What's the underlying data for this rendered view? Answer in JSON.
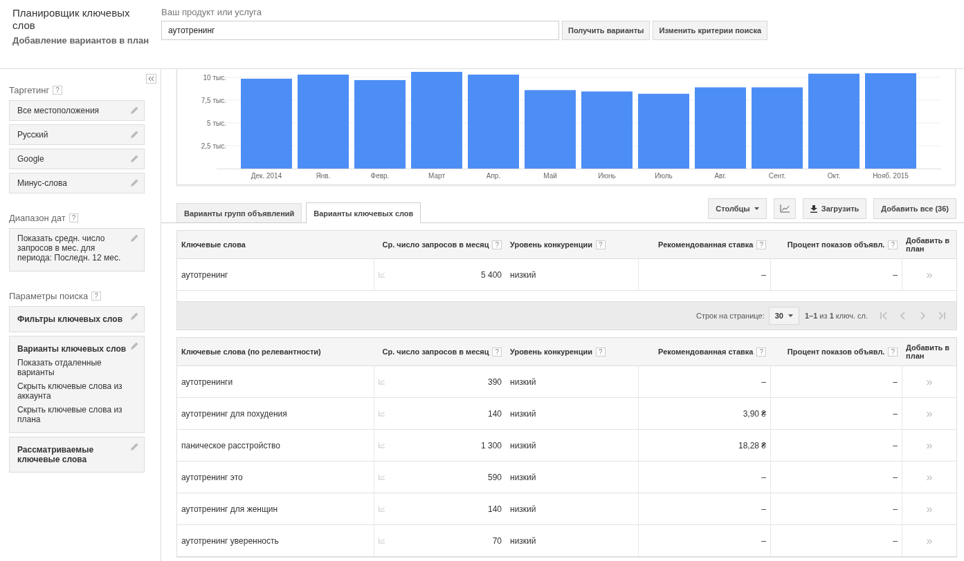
{
  "header": {
    "title": "Планировщик ключевых слов",
    "subtitle": "Добавление вариантов в план",
    "search_label": "Ваш продукт или услуга",
    "search_value": "аутотренинг",
    "buttons": [
      "Получить варианты",
      "Изменить критерии поиска"
    ]
  },
  "sidebar": {
    "sections": [
      {
        "title": "Таргетинг",
        "help": "?",
        "cards": [
          {
            "kind": "plain",
            "text": "Все местоположения"
          },
          {
            "kind": "plain",
            "text": "Русский"
          },
          {
            "kind": "plain",
            "text": "Google"
          },
          {
            "kind": "plain",
            "text": "Минус-слова"
          }
        ]
      },
      {
        "title": "Диапазон дат",
        "help": "?",
        "cards": [
          {
            "kind": "plain",
            "text": "Показать средн. число запросов в мес. для периода: Последн. 12 мес."
          }
        ]
      },
      {
        "title": "Параметры поиска",
        "help": "?",
        "cards": [
          {
            "kind": "bold",
            "text": "Фильтры ключевых слов"
          },
          {
            "kind": "bold",
            "text": "Варианты ключевых слов",
            "lines": [
              "Показать отдаленные варианты",
              "Скрыть ключевые слова из аккаунта",
              "Скрыть ключевые слова из плана"
            ]
          },
          {
            "kind": "bold",
            "text": "Рассматриваемые ключевые слова"
          }
        ]
      }
    ]
  },
  "chart": {
    "chart_data": {
      "type": "bar",
      "grid": true,
      "categories": [
        "Дек. 2014",
        "Янв.",
        "Февр.",
        "Март",
        "Апр.",
        "Май",
        "Июнь",
        "Июль",
        "Авг.",
        "Сент.",
        "Окт.",
        "Нояб. 2015"
      ],
      "values": [
        9.85,
        10.3,
        9.7,
        10.6,
        10.3,
        8.6,
        8.45,
        8.2,
        8.9,
        8.9,
        10.4,
        10.45
      ],
      "ylim": [
        0,
        10.6
      ],
      "yticks": [
        {
          "value": 2.5,
          "label": "2,5 тыс."
        },
        {
          "value": 5,
          "label": "5 тыс."
        },
        {
          "value": 7.5,
          "label": "7,5 тыс."
        },
        {
          "value": 10,
          "label": "10 тыс."
        }
      ]
    }
  },
  "tabs": [
    {
      "label": "Варианты групп объявлений",
      "selected": false
    },
    {
      "label": "Варианты ключевых слов",
      "selected": true
    }
  ],
  "toolbar": {
    "columns": "Столбцы",
    "download": "Загрузить",
    "add_all": "Добавить все (36)"
  },
  "search_table": {
    "columns": [
      {
        "label": "Ключевые слова"
      },
      {
        "label": "Ср. число запросов в месяц",
        "help": "?"
      },
      {
        "label": "Уровень конкуренции",
        "help": "?"
      },
      {
        "label": "Рекомендованная ставка",
        "help": "?"
      },
      {
        "label": "Процент показов объявл.",
        "help": "?"
      },
      {
        "label": "Добавить в план"
      }
    ],
    "rows": [
      {
        "keyword": "аутотренинг",
        "searches": "5 400",
        "competition": "низкий",
        "bid": "–",
        "share": "–",
        "add": "»"
      }
    ]
  },
  "pagination": {
    "rows_label": "Строк на странице:",
    "rows_value": "30",
    "range": "**1–1** из **1** ключ. сл."
  },
  "ideas_table": {
    "columns": [
      {
        "label": "Ключевые слова (по релевантности)"
      },
      {
        "label": "Ср. число запросов в месяц",
        "help": "?"
      },
      {
        "label": "Уровень конкуренции",
        "help": "?"
      },
      {
        "label": "Рекомендованная ставка",
        "help": "?"
      },
      {
        "label": "Процент показов объявл.",
        "help": "?"
      },
      {
        "label": "Добавить в план"
      }
    ],
    "rows": [
      {
        "keyword": "аутотренинги",
        "searches": "390",
        "competition": "низкий",
        "bid": "–",
        "share": "–",
        "add": "»"
      },
      {
        "keyword": "аутотренинг для похудения",
        "searches": "140",
        "competition": "низкий",
        "bid": "3,90 ₴",
        "share": "–",
        "add": "»"
      },
      {
        "keyword": "паническое расстройство",
        "searches": "1 300",
        "competition": "низкий",
        "bid": "18,28 ₴",
        "share": "–",
        "add": "»"
      },
      {
        "keyword": "аутотренинг это",
        "searches": "590",
        "competition": "низкий",
        "bid": "–",
        "share": "–",
        "add": "»"
      },
      {
        "keyword": "аутотренинг для женщин",
        "searches": "140",
        "competition": "низкий",
        "bid": "–",
        "share": "–",
        "add": "»"
      },
      {
        "keyword": "аутотренинг уверенность",
        "searches": "70",
        "competition": "низкий",
        "bid": "–",
        "share": "–",
        "add": "»"
      }
    ]
  }
}
